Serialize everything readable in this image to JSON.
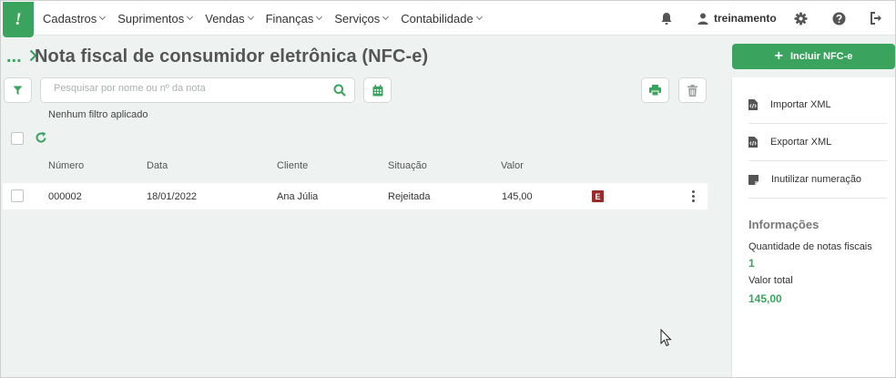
{
  "nav": {
    "logo": "!",
    "menu": [
      "Cadastros",
      "Suprimentos",
      "Vendas",
      "Finanças",
      "Serviços",
      "Contabilidade"
    ],
    "user": "treinamento"
  },
  "page": {
    "breadcrumb": "...",
    "title": "Nota fiscal de consumidor eletrônica (NFC-e)"
  },
  "search": {
    "placeholder": "Pesquisar por nome ou nº da nota",
    "value": ""
  },
  "filter_status": "Nenhum filtro aplicado",
  "table": {
    "columns": [
      "Número",
      "Data",
      "Cliente",
      "Situação",
      "Valor"
    ],
    "rows": [
      {
        "numero": "000002",
        "data": "18/01/2022",
        "cliente": "Ana Júlia",
        "situacao": "Rejeitada",
        "valor": "145,00",
        "badge": "E"
      }
    ]
  },
  "side": {
    "include_button": "Incluir NFC-e",
    "actions": [
      "Importar XML",
      "Exportar XML",
      "Inutilizar numeração"
    ],
    "info": {
      "title": "Informações",
      "count_label": "Quantidade de notas fiscais",
      "count_value": "1",
      "total_label": "Valor total",
      "total_value": "145,00"
    }
  },
  "colors": {
    "brand_green": "#3aa35e",
    "rejected_badge": "#9b2a2a",
    "page_bg": "#eef3f2"
  }
}
